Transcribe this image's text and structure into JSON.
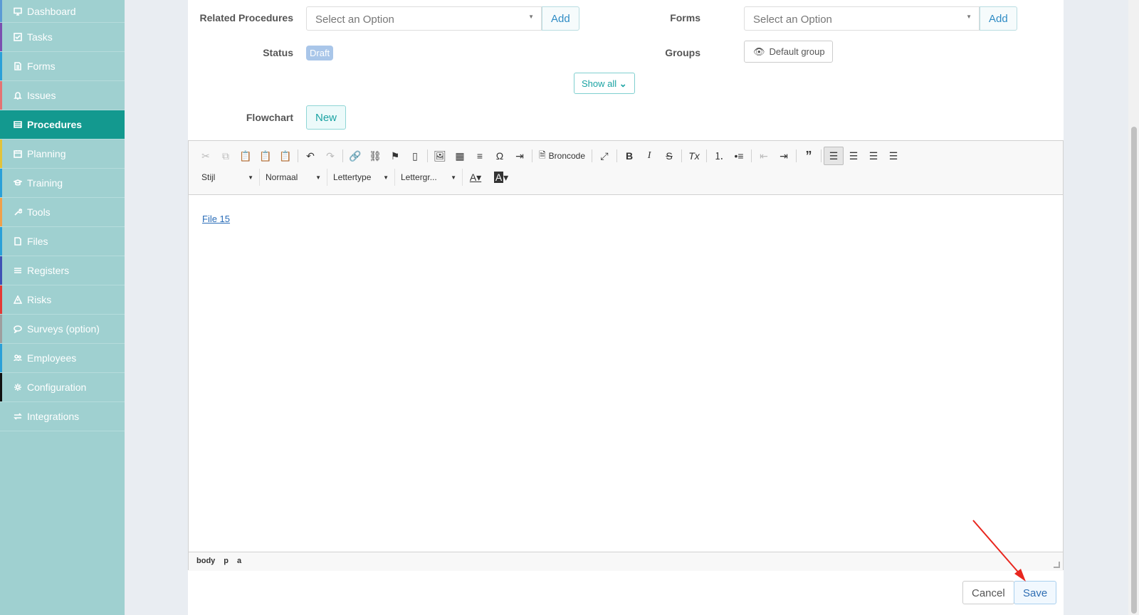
{
  "sidebar": {
    "items": [
      {
        "label": "Dashboard",
        "icon": "monitor-icon",
        "color": "#5b9bd5"
      },
      {
        "label": "Tasks",
        "icon": "checkbox-icon",
        "color": "#7b4fb0"
      },
      {
        "label": "Forms",
        "icon": "document-icon",
        "color": "#2aa0d8"
      },
      {
        "label": "Issues",
        "icon": "bell-icon",
        "color": "#e57373"
      },
      {
        "label": "Procedures",
        "icon": "list-icon",
        "color": "#13998f"
      },
      {
        "label": "Planning",
        "icon": "calendar-icon",
        "color": "#e2c33a"
      },
      {
        "label": "Training",
        "icon": "graduation-cap-icon",
        "color": "#2aa0d8"
      },
      {
        "label": "Tools",
        "icon": "wrench-icon",
        "color": "#f0a04b"
      },
      {
        "label": "Files",
        "icon": "file-icon",
        "color": "#2aa0d8"
      },
      {
        "label": "Registers",
        "icon": "list-lines-icon",
        "color": "#3f51b5"
      },
      {
        "label": "Risks",
        "icon": "warning-icon",
        "color": "#e53935"
      },
      {
        "label": "Surveys (option)",
        "icon": "chat-icon",
        "color": "#9e9e9e"
      },
      {
        "label": "Employees",
        "icon": "users-icon",
        "color": "#2aa0d8"
      },
      {
        "label": "Configuration",
        "icon": "gear-icon",
        "color": "#111111"
      },
      {
        "label": "Integrations",
        "icon": "exchange-icon",
        "color": "#9fd0d0"
      }
    ]
  },
  "form": {
    "related_procedures_label": "Related Procedures",
    "related_procedures_placeholder": "Select an Option",
    "forms_label": "Forms",
    "forms_placeholder": "Select an Option",
    "add_label": "Add",
    "status_label": "Status",
    "status_value": "Draft",
    "groups_label": "Groups",
    "group_value": "Default group",
    "show_all_label": "Show all",
    "flowchart_label": "Flowchart",
    "new_label": "New"
  },
  "editor": {
    "source_label": "Broncode",
    "style_combo": "Stijl",
    "format_combo": "Normaal",
    "font_combo": "Lettertype",
    "size_combo": "Lettergr...",
    "content_link": "File 15",
    "path": [
      "body",
      "p",
      "a"
    ]
  },
  "footer": {
    "cancel_label": "Cancel",
    "save_label": "Save"
  },
  "colors": {
    "accent": "#13998f",
    "sidebar_bg": "#9fd0d0",
    "annotation_arrow": "#e8261e"
  }
}
